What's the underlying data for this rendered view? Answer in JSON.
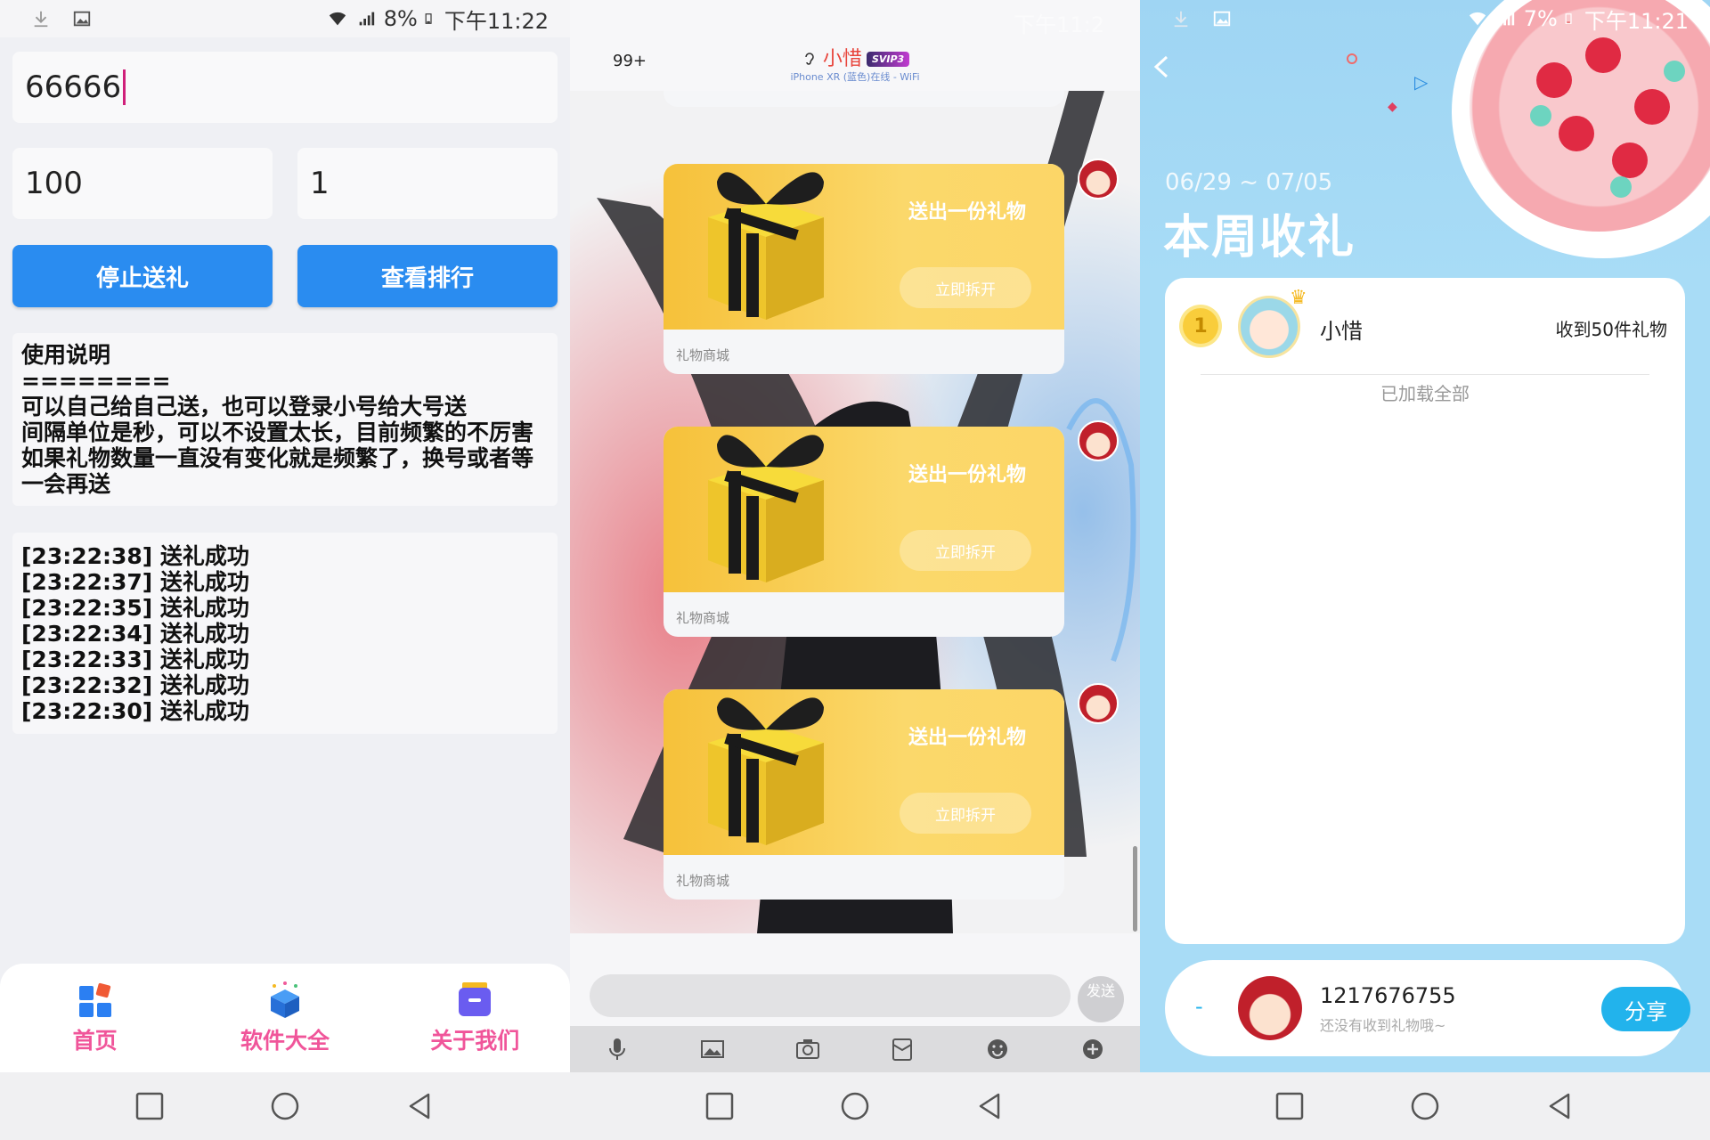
{
  "panel1": {
    "status": {
      "battery": "8%",
      "time": "下午11:22"
    },
    "code_field": {
      "value": "66666"
    },
    "interval_field": {
      "value": "100"
    },
    "count_field": {
      "value": "1"
    },
    "stop_button": "停止送礼",
    "rank_button": "查看排行",
    "instructions": {
      "title": "使用说明",
      "divider": "========",
      "lines": [
        "可以自己给自己送，也可以登录小号给大号送",
        "间隔单位是秒，可以不设置太长，目前频繁的不厉害",
        "如果礼物数量一直没有变化就是频繁了，换号或者等",
        "一会再送"
      ]
    },
    "log": [
      "[23:22:38] 送礼成功",
      "[23:22:37] 送礼成功",
      "[23:22:35] 送礼成功",
      "[23:22:34] 送礼成功",
      "[23:22:33] 送礼成功",
      "[23:22:32] 送礼成功",
      "[23:22:30] 送礼成功"
    ],
    "nav": [
      {
        "label": "首页",
        "icon": "home-grid-icon"
      },
      {
        "label": "软件大全",
        "icon": "software-box-icon"
      },
      {
        "label": "关于我们",
        "icon": "about-folder-icon"
      }
    ]
  },
  "panel2": {
    "status": {
      "time": "下午11:2"
    },
    "unread": "99+",
    "contact_name": "小惜",
    "vip_badge": "SVIP3",
    "device_status": "iPhone XR (蓝色)在线 - WiFi",
    "gifts": [
      {
        "title": "送出一份礼物",
        "open": "立即拆开",
        "source": "礼物商城"
      },
      {
        "title": "送出一份礼物",
        "open": "立即拆开",
        "source": "礼物商城"
      },
      {
        "title": "送出一份礼物",
        "open": "立即拆开",
        "source": "礼物商城"
      }
    ],
    "send_button": "发送"
  },
  "panel3": {
    "status": {
      "battery": "7%",
      "time": "下午11:21"
    },
    "date_range": "06/29 ~ 07/05",
    "title": "本周收礼",
    "ranking": [
      {
        "rank": "1",
        "name": "小惜",
        "received": "收到50件礼物"
      }
    ],
    "loaded_all": "已加载全部",
    "me": {
      "rank": "-",
      "id": "1217676755",
      "subtitle": "还没有收到礼物哦~",
      "share": "分享"
    }
  },
  "colors": {
    "primary_blue": "#2a8cf0",
    "nav_pink": "#f0559a",
    "gift_yellow": "#f6c13a",
    "share_cyan": "#22b3ec",
    "sky_blue": "#a8dcf6"
  }
}
